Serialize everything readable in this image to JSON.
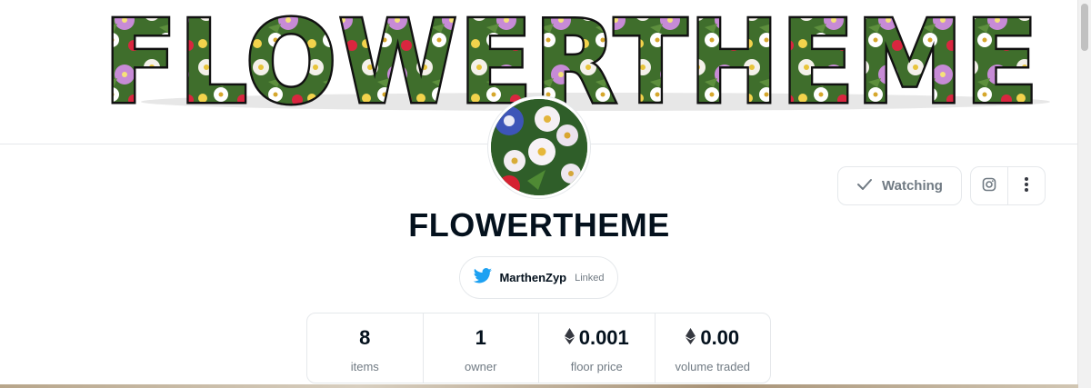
{
  "banner": {
    "text": "FLOWERTHEME"
  },
  "collection": {
    "name": "FLOWERTHEME"
  },
  "actions": {
    "watch_label": "Watching"
  },
  "twitter": {
    "handle": "MarthenZyp",
    "status": "Linked"
  },
  "stats": [
    {
      "value": "8",
      "label": "items",
      "icon": ""
    },
    {
      "value": "1",
      "label": "owner",
      "icon": ""
    },
    {
      "value": "0.001",
      "label": "floor price",
      "icon": "ethereum-icon"
    },
    {
      "value": "0.00",
      "label": "volume traded",
      "icon": "ethereum-icon"
    }
  ],
  "colors": {
    "text_primary": "#04111d",
    "text_secondary": "#707a83",
    "border": "#e5e8eb",
    "twitter_blue": "#1da1f2"
  }
}
